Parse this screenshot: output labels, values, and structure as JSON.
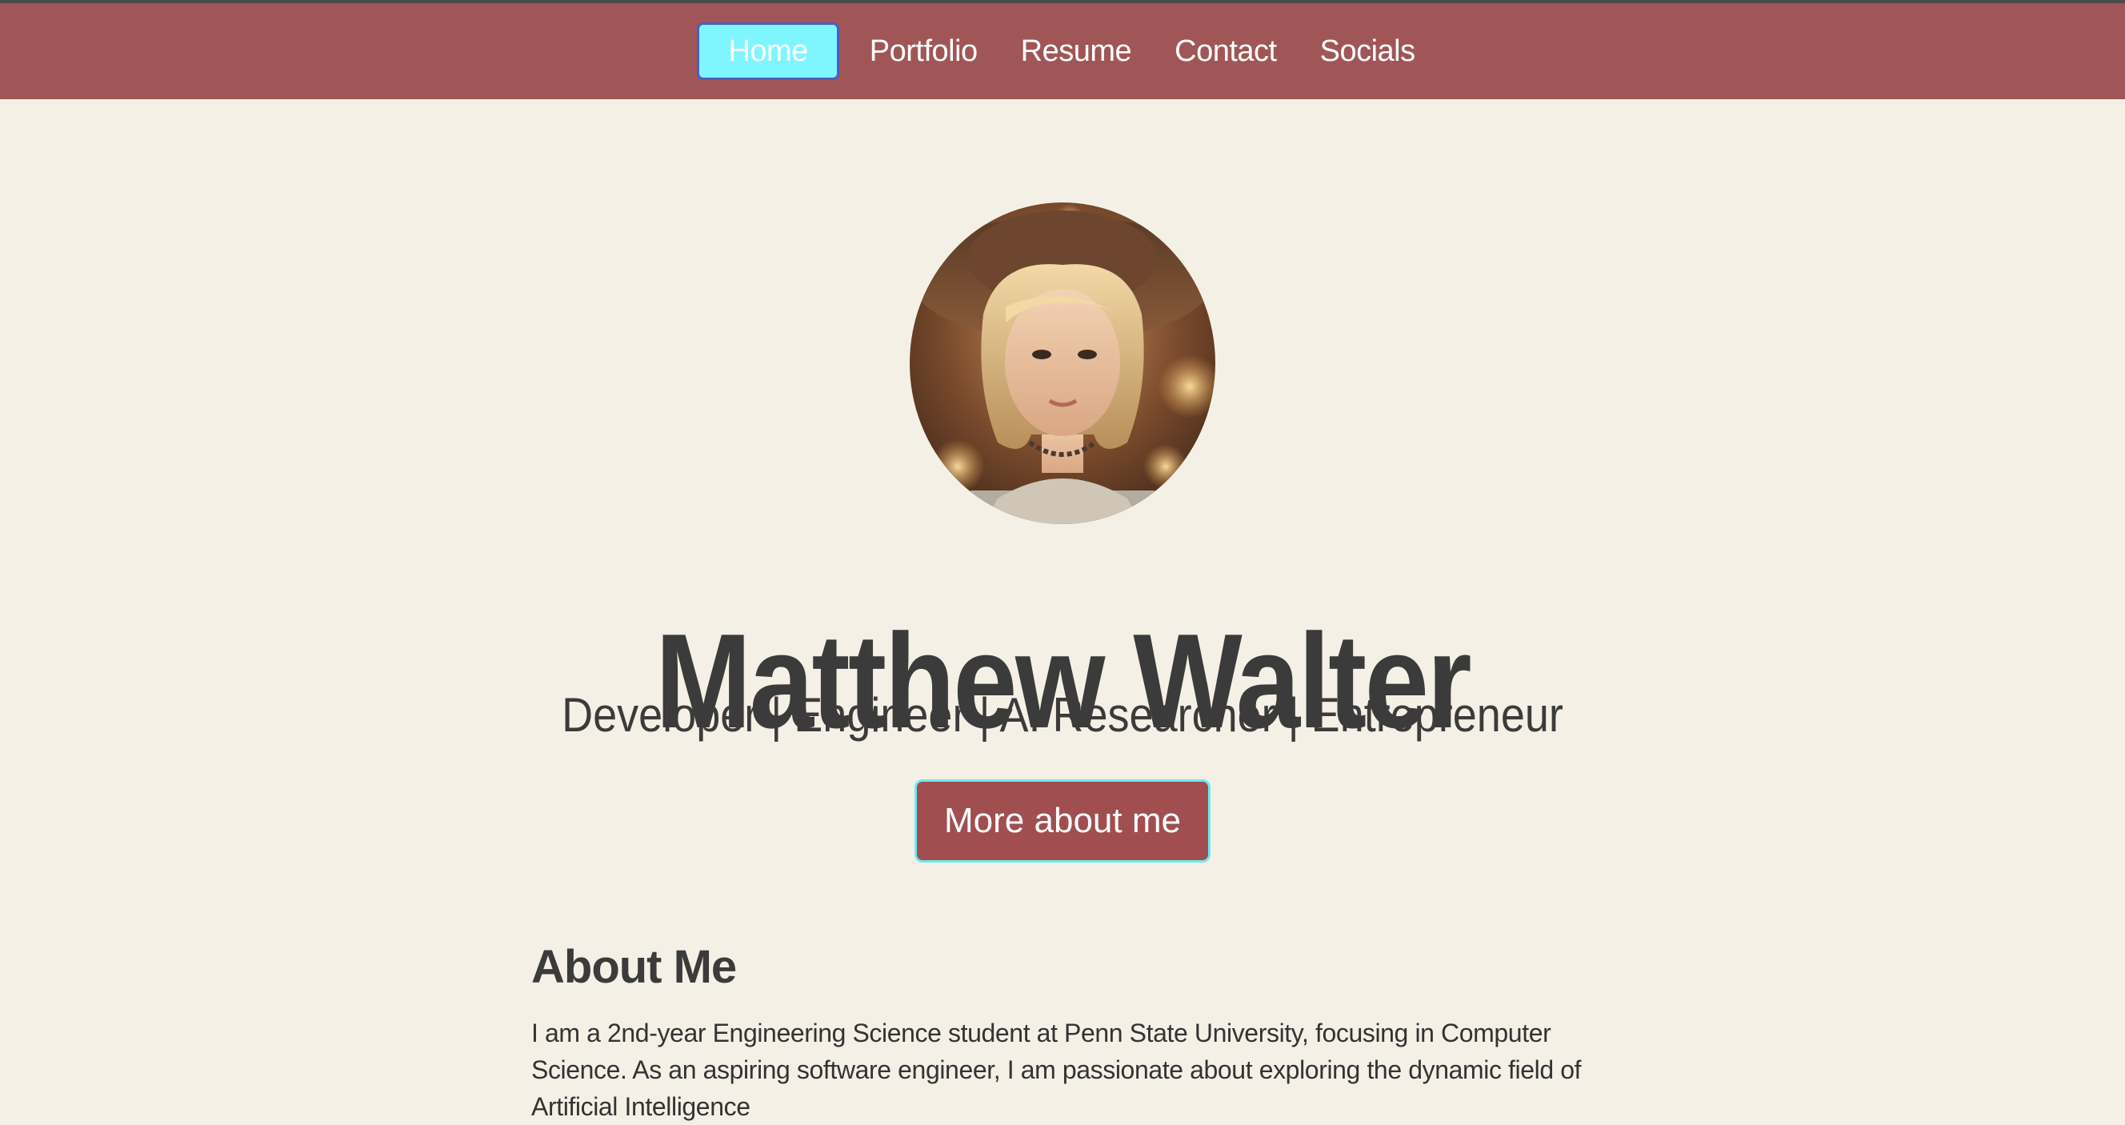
{
  "nav": {
    "items": [
      {
        "label": "Home",
        "active": true
      },
      {
        "label": "Portfolio",
        "active": false
      },
      {
        "label": "Resume",
        "active": false
      },
      {
        "label": "Contact",
        "active": false
      },
      {
        "label": "Socials",
        "active": false
      }
    ]
  },
  "hero": {
    "avatar_icon": "portrait-avatar",
    "name": "Matthew Walter",
    "tagline": "Developer | Engineer | AI Researcher | Entrepreneur",
    "cta_label": "More about me"
  },
  "about": {
    "title": "About Me",
    "text": "I am a 2nd-year Engineering Science student at Penn State University, focusing in Computer Science. As an aspiring software engineer, I am passionate about exploring the dynamic field of Artificial Intelligence"
  },
  "colors": {
    "nav_bg": "#a05657",
    "active_bg": "#7ff6ff",
    "page_bg": "#f5f0e6",
    "button_bg": "#a04e50",
    "button_border": "#6ee8f0"
  }
}
